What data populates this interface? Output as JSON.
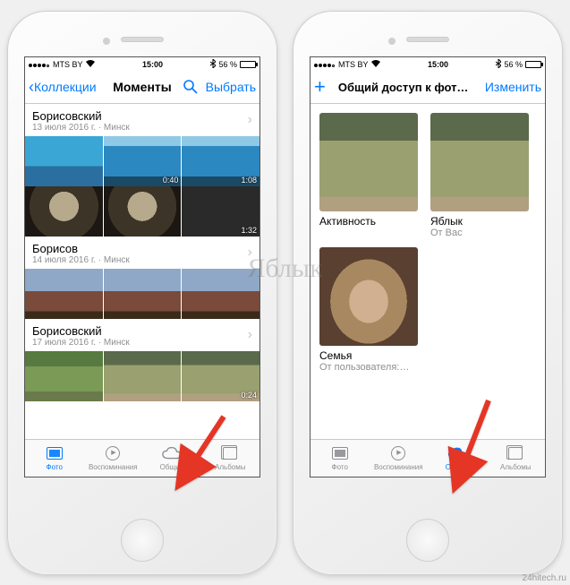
{
  "status": {
    "carrier": "MTS BY",
    "wifi": true,
    "time": "15:00",
    "bt": true,
    "battery_pct": "56 %",
    "battery_fill_pct": 56
  },
  "left": {
    "nav": {
      "back_label": "Коллекции",
      "title": "Моменты",
      "select_label": "Выбрать"
    },
    "sections": [
      {
        "title": "Борисовский",
        "subtitle": "13 июля 2016 г. · Минск",
        "rows": [
          [
            {
              "cls": "pool",
              "dur": null
            },
            {
              "cls": "pool2",
              "dur": "0:40"
            },
            {
              "cls": "pool2",
              "dur": "1:08"
            }
          ],
          [
            {
              "cls": "beard",
              "dur": null
            },
            {
              "cls": "beard",
              "dur": null
            },
            {
              "cls": "dark",
              "dur": "1:32"
            }
          ]
        ]
      },
      {
        "title": "Борисов",
        "subtitle": "14 июля 2016 г. · Минск",
        "rows": [
          [
            {
              "cls": "castle",
              "dur": null
            },
            {
              "cls": "castle",
              "dur": null
            },
            {
              "cls": "castle",
              "dur": null
            }
          ]
        ]
      },
      {
        "title": "Борисовский",
        "subtitle": "17 июля 2016 г. · Минск",
        "rows": [
          [
            {
              "cls": "green",
              "dur": null
            },
            {
              "cls": "grass",
              "dur": null
            },
            {
              "cls": "grass",
              "dur": "0:24"
            }
          ]
        ]
      }
    ],
    "tabs": [
      {
        "label": "Фото",
        "active": true,
        "icon": "photos"
      },
      {
        "label": "Воспоминания",
        "active": false,
        "icon": "memories"
      },
      {
        "label": "Общие",
        "active": false,
        "icon": "cloud"
      },
      {
        "label": "Альбомы",
        "active": false,
        "icon": "albums"
      }
    ]
  },
  "right": {
    "nav": {
      "add_label": "+",
      "title": "Общий доступ к фото iCl…",
      "edit_label": "Изменить"
    },
    "albums": [
      {
        "name": "Активность",
        "owner": "",
        "cls": "grass"
      },
      {
        "name": "Яблык",
        "owner": "От Вас",
        "cls": "grass"
      },
      {
        "name": "Семья",
        "owner": "От пользователя:…",
        "cls": "cat"
      }
    ],
    "tabs": [
      {
        "label": "Фото",
        "active": false,
        "icon": "photos"
      },
      {
        "label": "Воспоминания",
        "active": false,
        "icon": "memories"
      },
      {
        "label": "Общие",
        "active": true,
        "icon": "cloud"
      },
      {
        "label": "Альбомы",
        "active": false,
        "icon": "albums"
      }
    ]
  },
  "watermark": "Яблык",
  "credits": "24hitech.ru"
}
